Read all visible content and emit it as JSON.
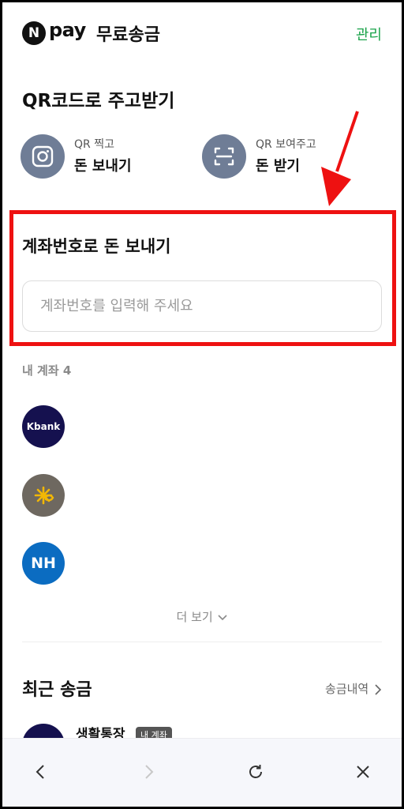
{
  "header": {
    "logo_letter": "N",
    "brand": "pay",
    "title": "무료송금",
    "manage_label": "관리"
  },
  "qr_section": {
    "title": "QR코드로 주고받기",
    "scan": {
      "small": "QR 찍고",
      "big": "돈 보내기",
      "icon": "camera-icon"
    },
    "show": {
      "small": "QR 보여주고",
      "big": "돈 받기",
      "icon": "qr-scan-frame-icon"
    }
  },
  "account_send": {
    "title": "계좌번호로 돈 보내기",
    "input_placeholder": "계좌번호를 입력해 주세요",
    "input_value": ""
  },
  "my_accounts": {
    "label": "내 계좌 4",
    "banks": [
      {
        "name": "Kbank",
        "color": "#15114f"
      },
      {
        "name": "KB",
        "color": "#6e6860"
      },
      {
        "name": "NH",
        "color": "#0b6cc1"
      }
    ]
  },
  "more_label": "더 보기",
  "recent": {
    "title": "최근 송금",
    "history_label": "송금내역",
    "items": [
      {
        "name": "생활통장",
        "badge": "내 계좌"
      }
    ]
  },
  "colors": {
    "accent_green": "#1aa34a",
    "highlight_red": "#ee1111",
    "qr_icon_bg": "#6f7d96"
  },
  "bottom_nav": [
    "back-icon",
    "forward-icon",
    "refresh-icon",
    "close-icon"
  ]
}
